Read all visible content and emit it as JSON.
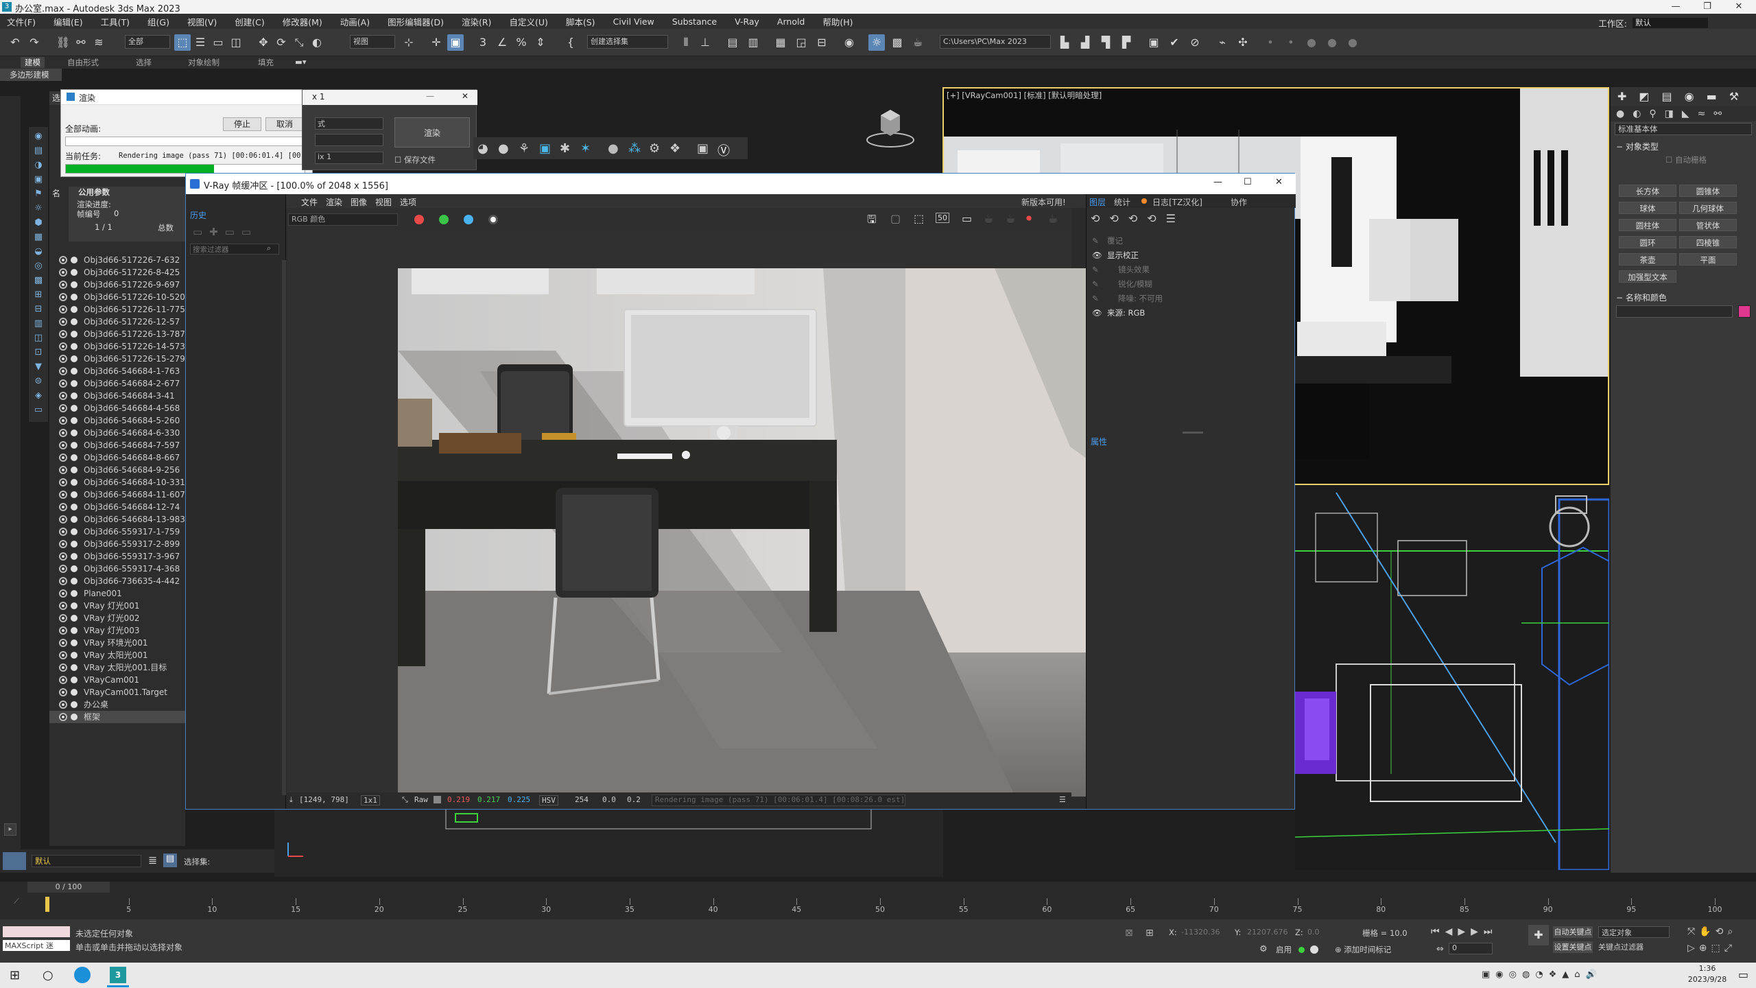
{
  "window": {
    "title": "办公室.max - Autodesk 3ds Max 2023"
  },
  "menubar": {
    "items": [
      "文件(F)",
      "编辑(E)",
      "工具(T)",
      "组(G)",
      "视图(V)",
      "创建(C)",
      "修改器(M)",
      "动画(A)",
      "图形编辑器(D)",
      "渲染(R)",
      "自定义(U)",
      "脚本(S)",
      "Civil View",
      "Substance",
      "V-Ray",
      "Arnold",
      "帮助(H)"
    ],
    "workspace_label": "工作区:",
    "workspace_value": "默认"
  },
  "toolbar": {
    "selection_filter": "全部",
    "ref_coord": "视图",
    "selection_set": "创建选择集",
    "path": "C:\\Users\\PC\\Max 2023"
  },
  "ribbon": {
    "tabs": [
      "建模",
      "自由形式",
      "选择",
      "对象绘制",
      "填充"
    ],
    "subtab": "多边形建模"
  },
  "scene_explorer": {
    "label_select": "选择",
    "label_name": "名",
    "objects": [
      "Obj3d66-517226-7-632",
      "Obj3d66-517226-8-425",
      "Obj3d66-517226-9-697",
      "Obj3d66-517226-10-520",
      "Obj3d66-517226-11-775",
      "Obj3d66-517226-12-57",
      "Obj3d66-517226-13-787",
      "Obj3d66-517226-14-573",
      "Obj3d66-517226-15-279",
      "Obj3d66-546684-1-763",
      "Obj3d66-546684-2-677",
      "Obj3d66-546684-3-41",
      "Obj3d66-546684-4-568",
      "Obj3d66-546684-5-260",
      "Obj3d66-546684-6-330",
      "Obj3d66-546684-7-597",
      "Obj3d66-546684-8-667",
      "Obj3d66-546684-9-256",
      "Obj3d66-546684-10-331",
      "Obj3d66-546684-11-607",
      "Obj3d66-546684-12-74",
      "Obj3d66-546684-13-983",
      "Obj3d66-559317-1-759",
      "Obj3d66-559317-2-899",
      "Obj3d66-559317-3-967",
      "Obj3d66-559317-4-368",
      "Obj3d66-736635-4-442",
      "Plane001",
      "VRay 灯光001",
      "VRay 灯光002",
      "VRay 灯光003",
      "VRay 环境光001",
      "VRay 太阳光001",
      "VRay 太阳光001.目标",
      "VRayCam001",
      "VRayCam001.Target",
      "办公桌",
      "框架"
    ]
  },
  "render_progress": {
    "title": "渲染",
    "label_all": "全部动画:",
    "label_current": "当前任务:",
    "current_task": "Rendering image (pass 71) [00:06:01.4] [00:08:",
    "stop": "停止",
    "cancel": "取消",
    "progress": 0.62,
    "common_params": "公用参数",
    "render_progress_label": "渲染进度:",
    "frame_label": "帧编号",
    "frame_value": "0",
    "count": "1 / 1",
    "total": "总数"
  },
  "render_setup": {
    "title": "x 1",
    "render_button": "渲染",
    "save_file": "保存文件",
    "preset": "ix 1",
    "dropdown": "式"
  },
  "vfb": {
    "title": "V-Ray 帧缓冲区 - [100.0% of 2048 x 1556]",
    "menus": [
      "文件",
      "渲染",
      "图像",
      "视图",
      "选项"
    ],
    "history_tab": "历史",
    "update_notice": "新版本可用!",
    "channel": "RGB 颜色",
    "filter_placeholder": "搜索过滤器",
    "zoom_badge": "50",
    "layers_tabs": [
      "图层",
      "统计",
      "日志[TZ汉化]",
      "协作"
    ],
    "layers": [
      "覆记",
      "显示校正",
      "镜头效果",
      "锐化/模糊",
      "降噪: 不可用",
      "来源: RGB"
    ],
    "properties_label": "属性",
    "status": {
      "coords": "[1249, 798]",
      "zoom": "1x1",
      "mode": "Raw",
      "r": "0.219",
      "g": "0.217",
      "b": "0.225",
      "colorspace": "HSV",
      "v1": "254",
      "v2": "0.0",
      "v3": "0.2",
      "message": "Rendering image (pass 71) [00:06:01.4] [00:08:26.0 est]"
    }
  },
  "viewport": {
    "label": "[+] [VRayCam001] [标准] [默认明暗处理]"
  },
  "command_panel": {
    "dropdown": "标准基本体",
    "section_object_type": "对象类型",
    "autogrid": "自动栅格",
    "buttons": [
      "长方体",
      "圆锥体",
      "球体",
      "几何球体",
      "圆柱体",
      "管状体",
      "圆环",
      "四棱锥",
      "茶壶",
      "平面",
      "加强型文本"
    ],
    "section_name_color": "名称和颜色",
    "accent_color": "#e0388f"
  },
  "layer_bar": {
    "layer": "默认",
    "selection_set_label": "选择集:"
  },
  "timeline": {
    "frame": "0 / 100",
    "ticks": [
      0,
      5,
      10,
      15,
      20,
      25,
      30,
      35,
      40,
      45,
      50,
      55,
      60,
      65,
      70,
      75,
      80,
      85,
      90,
      95,
      100
    ]
  },
  "status": {
    "maxscript": "MAXScript 迷",
    "line1": "未选定任何对象",
    "line2": "单击或单击并拖动以选择对象",
    "x_label": "X:",
    "x": "-11320.36",
    "y_label": "Y:",
    "y": "21207.676",
    "z_label": "Z:",
    "z": "0.0",
    "grid": "栅格 = 10.0",
    "enable": "启用",
    "add_time_tag": "添加时间标记",
    "auto_key": "自动关键点",
    "set_key": "设置关键点",
    "selected": "选定对象",
    "key_filters": "关键点过滤器",
    "frame_field": "0"
  },
  "taskbar": {
    "time": "1:36",
    "date": "2023/9/28"
  }
}
